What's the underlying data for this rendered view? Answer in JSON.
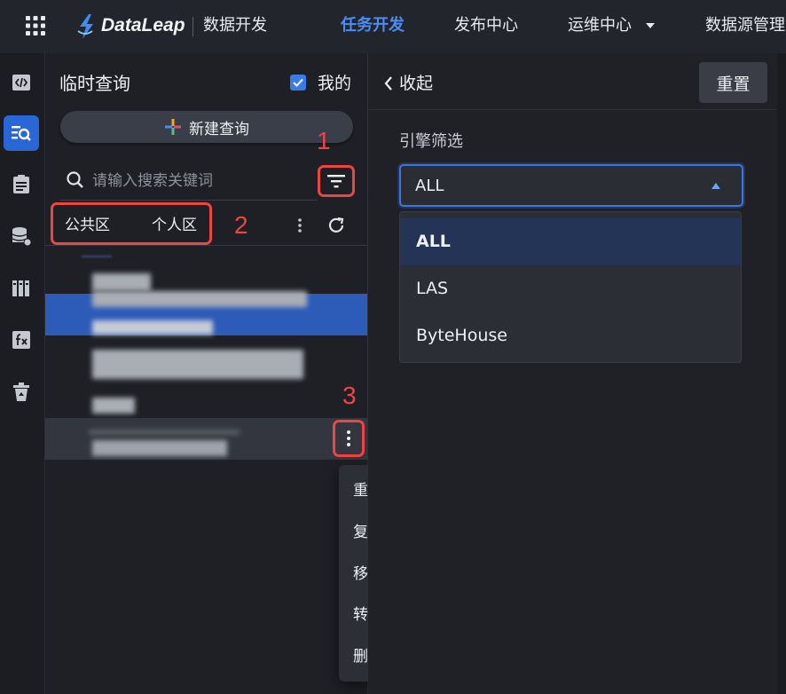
{
  "header": {
    "brand": "DataLeap",
    "product": "数据开发",
    "nav": [
      {
        "label": "任务开发",
        "active": true
      },
      {
        "label": "发布中心"
      },
      {
        "label": "运维中心",
        "has_dropdown": true
      },
      {
        "label": "数据源管理"
      }
    ]
  },
  "rail": {
    "icons": [
      {
        "name": "code-icon"
      },
      {
        "name": "query-icon",
        "active": true
      },
      {
        "name": "task-list-icon"
      },
      {
        "name": "database-icon"
      },
      {
        "name": "library-icon"
      },
      {
        "name": "function-icon"
      },
      {
        "name": "recycle-bin-icon"
      }
    ]
  },
  "panel": {
    "title": "临时查询",
    "mine_label": "我的",
    "mine_checked": true,
    "new_query_label": "新建查询",
    "search_placeholder": "请输入搜索关键词",
    "tabs": {
      "public": "公共区",
      "personal": "个人区"
    }
  },
  "annotations": {
    "one": "1",
    "two": "2",
    "three": "3",
    "color": "#ef4444"
  },
  "context_menu": {
    "items": [
      "重命名",
      "复制",
      "移动",
      "转换",
      "删除"
    ]
  },
  "drawer": {
    "collapse_label": "收起",
    "reset_label": "重置",
    "engine_label": "引擎筛选",
    "engine_value": "ALL",
    "engine_options": [
      {
        "label": "ALL",
        "selected": true
      },
      {
        "label": "LAS"
      },
      {
        "label": "ByteHouse"
      }
    ]
  },
  "colors": {
    "accent": "#3d74e0",
    "nav_active": "#4c8cf5",
    "background": "#1c1e24",
    "annotation": "#ef4444"
  }
}
